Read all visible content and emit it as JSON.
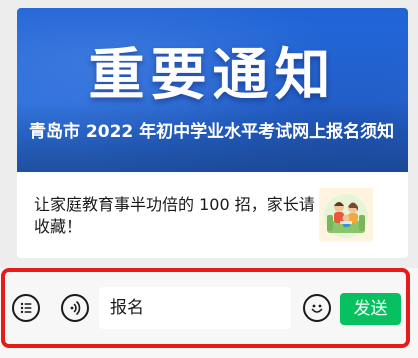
{
  "article": {
    "banner_title": "重要通知",
    "title": "青岛市 2022 年初中学业水平考试网上报名须知"
  },
  "sub_article": {
    "title": "让家庭教育事半功倍的 100 招，家长请收藏！",
    "thumbnail_icon": "family-illustration"
  },
  "input_bar": {
    "menu_icon": "list-menu-icon",
    "voice_icon": "voice-icon",
    "input_value": "报名",
    "emoji_icon": "emoji-icon",
    "send_label": "发送",
    "send_color": "#07c160",
    "highlight_color": "#e61b1b"
  }
}
